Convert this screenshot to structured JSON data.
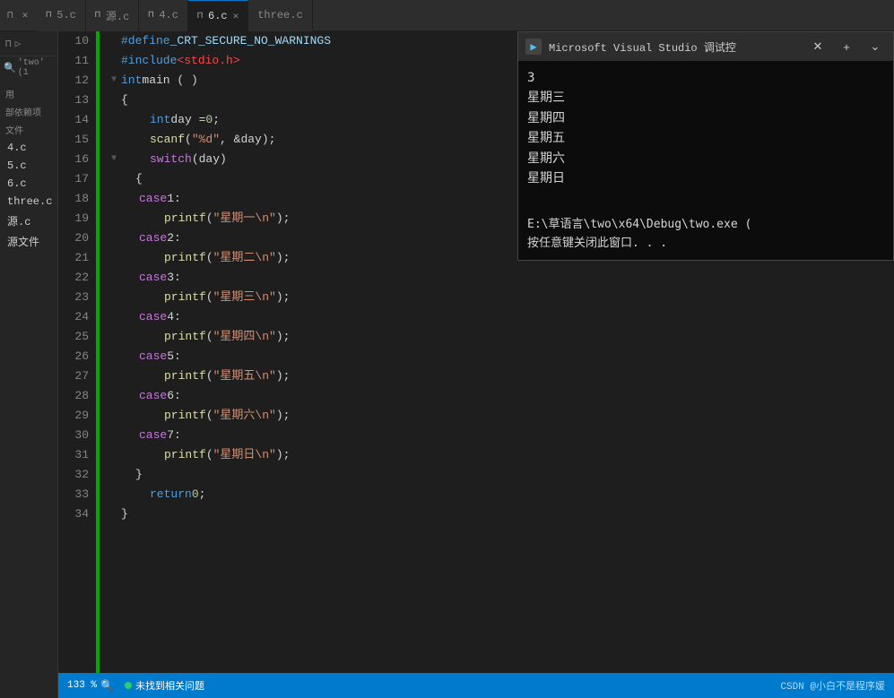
{
  "tabs": [
    {
      "label": "5.c",
      "pin": "⊓",
      "active": false,
      "closeable": false
    },
    {
      "label": "源.c",
      "pin": "⊓",
      "active": false,
      "closeable": false
    },
    {
      "label": "4.c",
      "pin": "⊓",
      "active": false,
      "closeable": false
    },
    {
      "label": "6.c",
      "pin": "⊓",
      "active": true,
      "closeable": true
    },
    {
      "label": "three.c",
      "pin": "",
      "active": false,
      "closeable": false
    }
  ],
  "sidebar": {
    "items": [
      "4.c",
      "5.c",
      "6.c",
      "three.c",
      "源.c",
      "源文件"
    ]
  },
  "code": {
    "lines": [
      {
        "num": 10,
        "content": "#define _CRT_SECURE_NO_WARNINGS",
        "type": "define"
      },
      {
        "num": 11,
        "content": "#include <stdio.h>",
        "type": "include"
      },
      {
        "num": 12,
        "content": "int main ( )",
        "type": "main",
        "fold": true
      },
      {
        "num": 13,
        "content": "{",
        "type": "brace"
      },
      {
        "num": 14,
        "content": "    int day = 0;",
        "type": "code"
      },
      {
        "num": 15,
        "content": "    scanf(\"%d\", &day);",
        "type": "code"
      },
      {
        "num": 16,
        "content": "    switch (day)",
        "type": "switch",
        "fold": true
      },
      {
        "num": 17,
        "content": "    {",
        "type": "brace"
      },
      {
        "num": 18,
        "content": "    case 1:",
        "type": "case"
      },
      {
        "num": 19,
        "content": "        printf(\"星期一\\n\");",
        "type": "printf"
      },
      {
        "num": 20,
        "content": "    case 2:",
        "type": "case"
      },
      {
        "num": 21,
        "content": "        printf(\"星期二\\n\");",
        "type": "printf"
      },
      {
        "num": 22,
        "content": "    case 3:",
        "type": "case"
      },
      {
        "num": 23,
        "content": "        printf(\"星期三\\n\");",
        "type": "printf"
      },
      {
        "num": 24,
        "content": "    case 4:",
        "type": "case"
      },
      {
        "num": 25,
        "content": "        printf(\"星期四\\n\");",
        "type": "printf"
      },
      {
        "num": 26,
        "content": "    case 5:",
        "type": "case"
      },
      {
        "num": 27,
        "content": "        printf(\"星期五\\n\");",
        "type": "printf"
      },
      {
        "num": 28,
        "content": "    case 6:",
        "type": "case"
      },
      {
        "num": 29,
        "content": "        printf(\"星期六\\n\");",
        "type": "printf"
      },
      {
        "num": 30,
        "content": "    case 7:",
        "type": "case"
      },
      {
        "num": 31,
        "content": "        printf(\"星期日\\n\");",
        "type": "printf"
      },
      {
        "num": 32,
        "content": "    }",
        "type": "brace"
      },
      {
        "num": 33,
        "content": "    return 0;",
        "type": "return"
      },
      {
        "num": 34,
        "content": "}",
        "type": "brace"
      }
    ]
  },
  "console": {
    "title": "Microsoft Visual Studio 调试控",
    "output": [
      "3",
      "星期三",
      "星期四",
      "星期五",
      "星期六",
      "星期日"
    ],
    "path": "E:\\草语言\\two\\x64\\Debug\\two.exe (",
    "prompt": "按任意键关闭此窗口. . ."
  },
  "status": {
    "zoom": "133 %",
    "message": "未找到相关问题",
    "watermark": "CSDN @小白不是程序媛"
  }
}
